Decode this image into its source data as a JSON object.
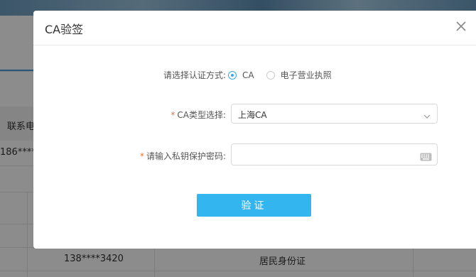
{
  "background": {
    "column_header": "联系电",
    "row1_phone": "186****2",
    "row2_phone": "138****3420",
    "row2_id_type": "居民身份证"
  },
  "dialog": {
    "title": "CA验签",
    "close_icon": "close-icon",
    "auth_method": {
      "label": "请选择认证方式:",
      "options": [
        "CA",
        "电子营业执照"
      ],
      "selected": "CA"
    },
    "ca_type": {
      "required_mark": "*",
      "label": "CA类型选择:",
      "value": "上海CA"
    },
    "password": {
      "required_mark": "*",
      "label": "请输入私钥保护密码:",
      "value": "",
      "icon": "keyboard-icon"
    },
    "verify_button": "验证"
  },
  "colors": {
    "accent": "#33b5f0",
    "radio_checked": "#3aa7e6",
    "required": "#e8742a"
  }
}
